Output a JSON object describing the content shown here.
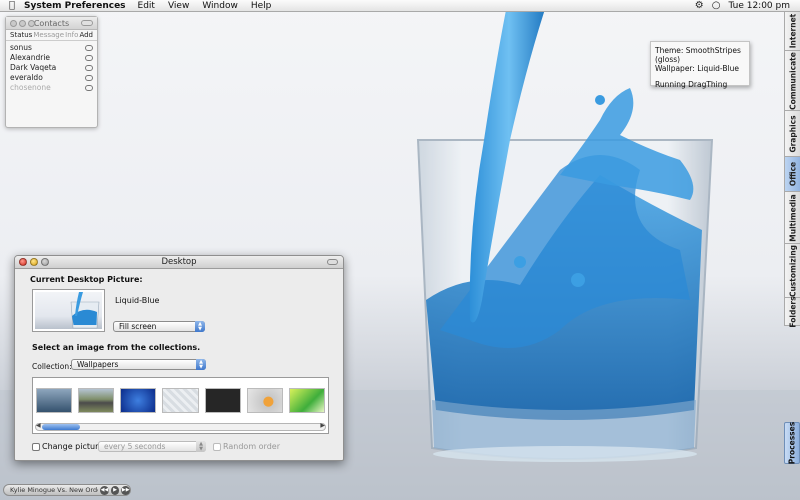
{
  "menubar": {
    "app_name": "System Preferences",
    "items": [
      "Edit",
      "View",
      "Window",
      "Help"
    ],
    "clock": "Tue 12:00 pm",
    "icons": [
      "apple-icon",
      "gear-icon",
      "chat-icon"
    ]
  },
  "contacts": {
    "title": "Contacts",
    "tabs": [
      "Status",
      "Message",
      "Info",
      "Add"
    ],
    "buddies": [
      {
        "name": "sonus",
        "online": true
      },
      {
        "name": "Alexandrie",
        "online": true
      },
      {
        "name": "Dark Vaqeta",
        "online": true
      },
      {
        "name": "everaldo",
        "online": true
      },
      {
        "name": "chosenone",
        "online": false
      }
    ]
  },
  "info_box": {
    "theme": "Theme: SmoothStripes (gloss)",
    "wallpaper": "Wallpaper: Liquid-Blue",
    "status": "Running DragThing"
  },
  "drawer_tabs": [
    "Internet",
    "Communicate",
    "Graphics",
    "Office",
    "Multimedia",
    "Customizing",
    "Folders"
  ],
  "drawer_active": "Office",
  "processes_label": "Processes",
  "desktop_window": {
    "title": "Desktop",
    "current_label": "Current Desktop Picture:",
    "picture_name": "Liquid-Blue",
    "fill_option": "Fill screen",
    "select_prompt": "Select an image from the collections.",
    "collection_label": "Collection:",
    "collection_value": "Wallpapers",
    "change_picture_label": "Change picture:",
    "interval_value": "every 5 seconds",
    "random_order_label": "Random order",
    "change_picture_checked": false,
    "random_order_checked": false
  },
  "music": {
    "track": "Kylie Minogue Vs. New Order"
  },
  "colors": {
    "water_blue": "#1f84cc",
    "selection_blue": "#3f78cc"
  }
}
